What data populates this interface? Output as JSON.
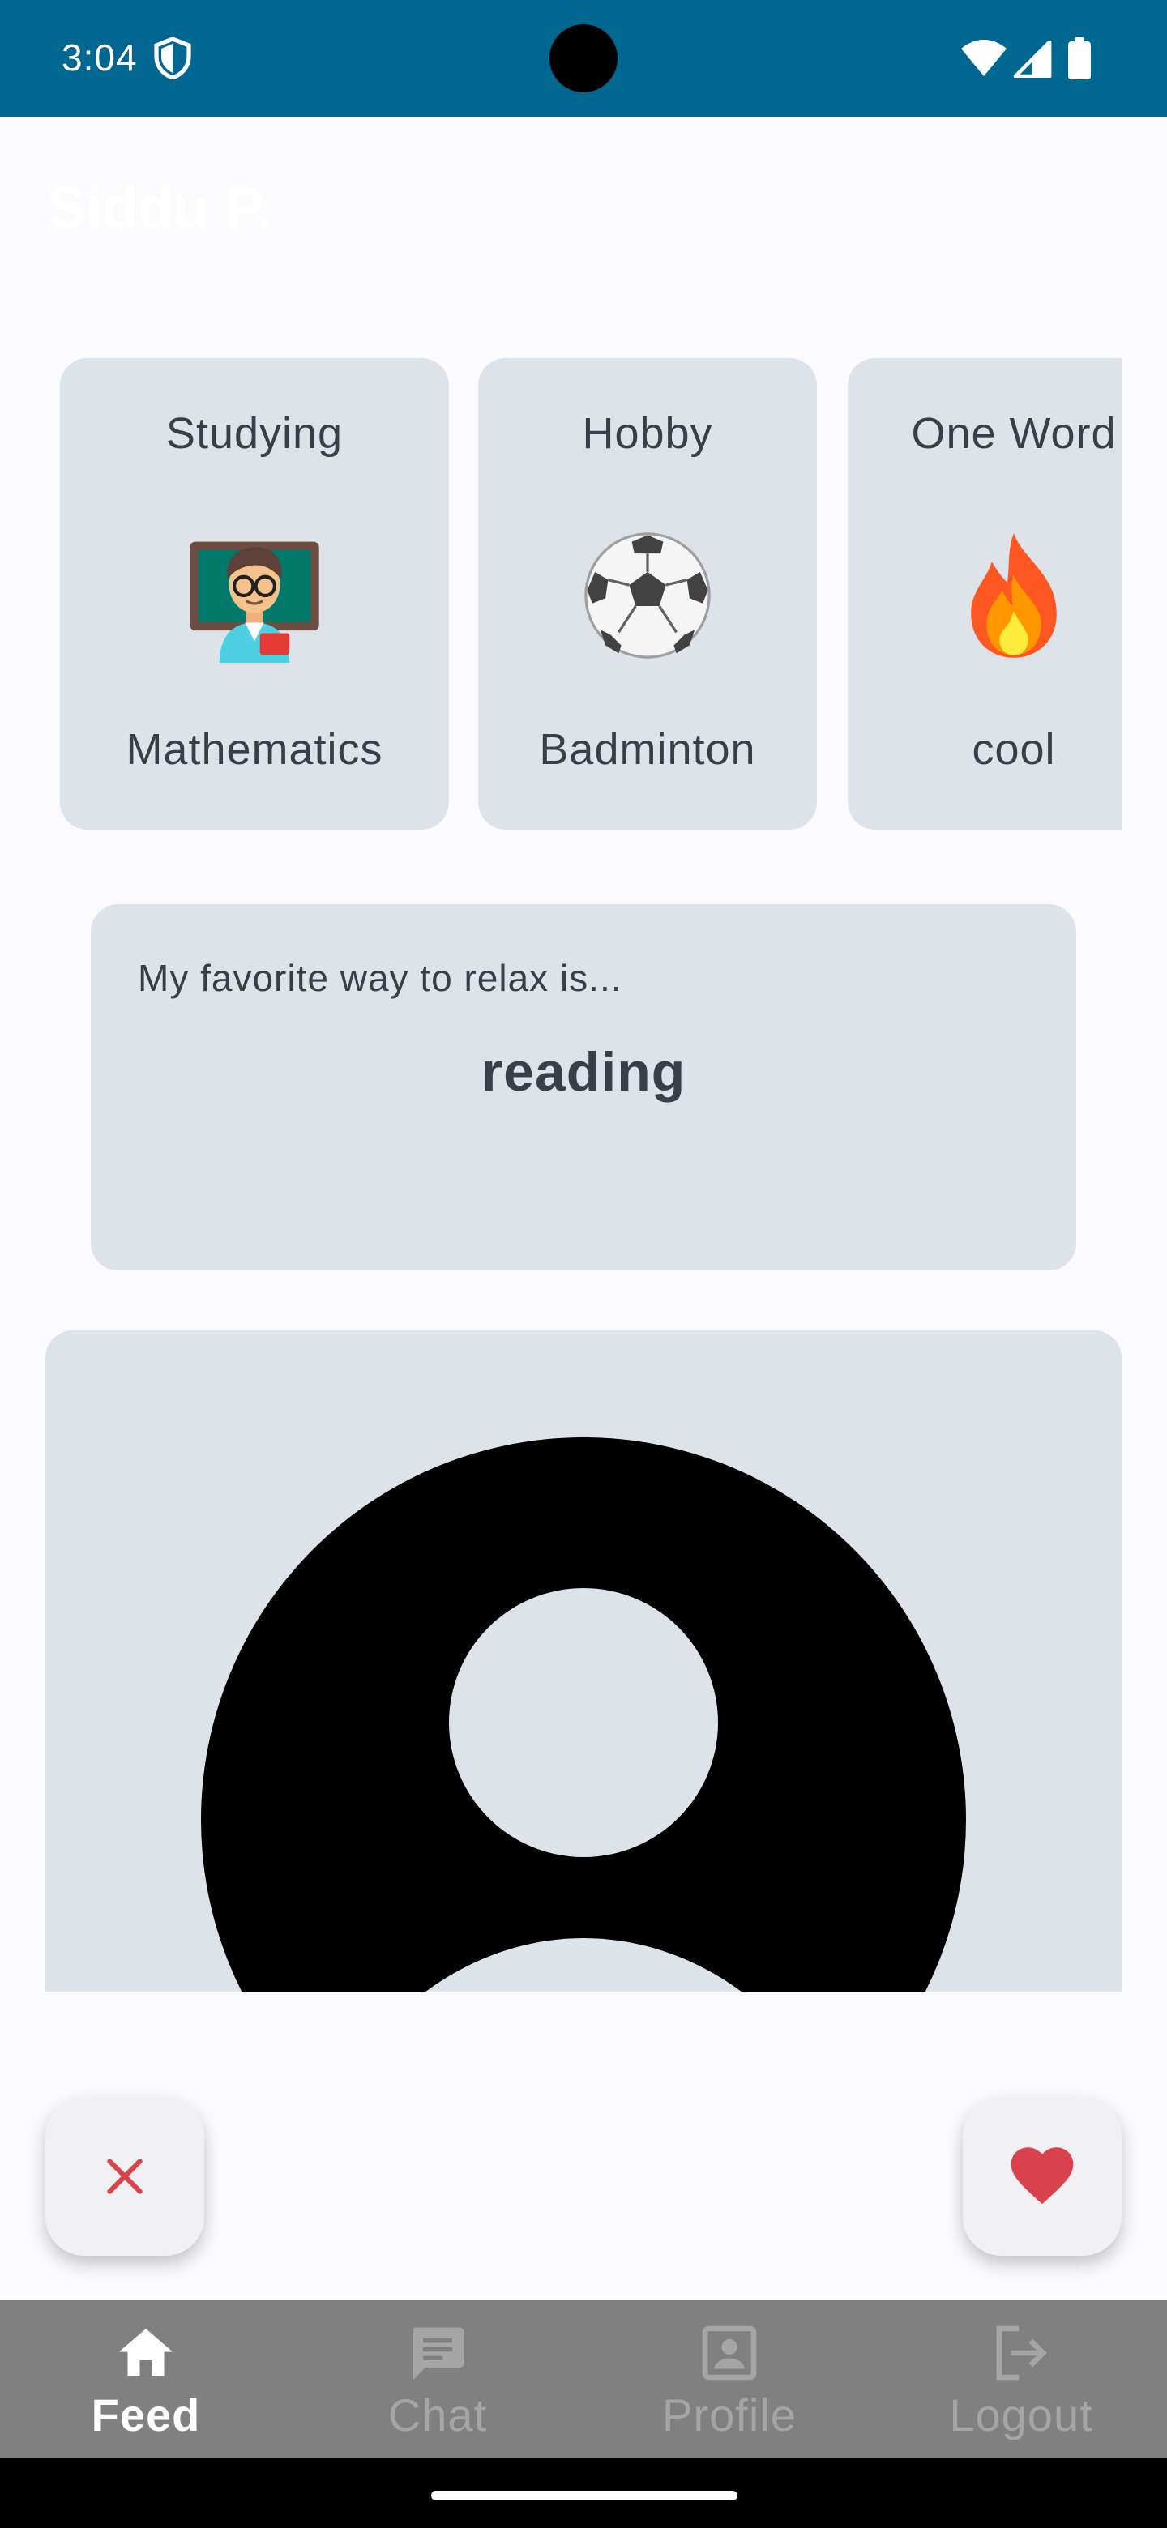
{
  "status_bar": {
    "time": "3:04"
  },
  "profile": {
    "name": "Siddu P."
  },
  "prompt_cards": [
    {
      "label": "Studying",
      "emoji": "teacher-emoji",
      "value": "Mathematics"
    },
    {
      "label": "Hobby",
      "emoji": "soccer-ball-emoji",
      "value": "Badminton"
    },
    {
      "label": "One Word",
      "emoji": "fire-emoji",
      "value": "cool"
    }
  ],
  "relax_prompt": {
    "question": "My favorite way to relax is...",
    "answer": "reading"
  },
  "photo": {
    "icon": "default-avatar-icon"
  },
  "actions": {
    "dismiss_icon": "close-icon",
    "like_icon": "heart-icon"
  },
  "bottom_nav": {
    "items": [
      {
        "label": "Feed",
        "icon": "home-icon",
        "active": true
      },
      {
        "label": "Chat",
        "icon": "chat-icon",
        "active": false
      },
      {
        "label": "Profile",
        "icon": "profile-icon",
        "active": false
      },
      {
        "label": "Logout",
        "icon": "logout-icon",
        "active": false
      }
    ]
  },
  "colors": {
    "status_bar": "#006890",
    "card_background": "#dde3e9",
    "nav_background": "#808080",
    "accent_red": "#d9414d"
  }
}
